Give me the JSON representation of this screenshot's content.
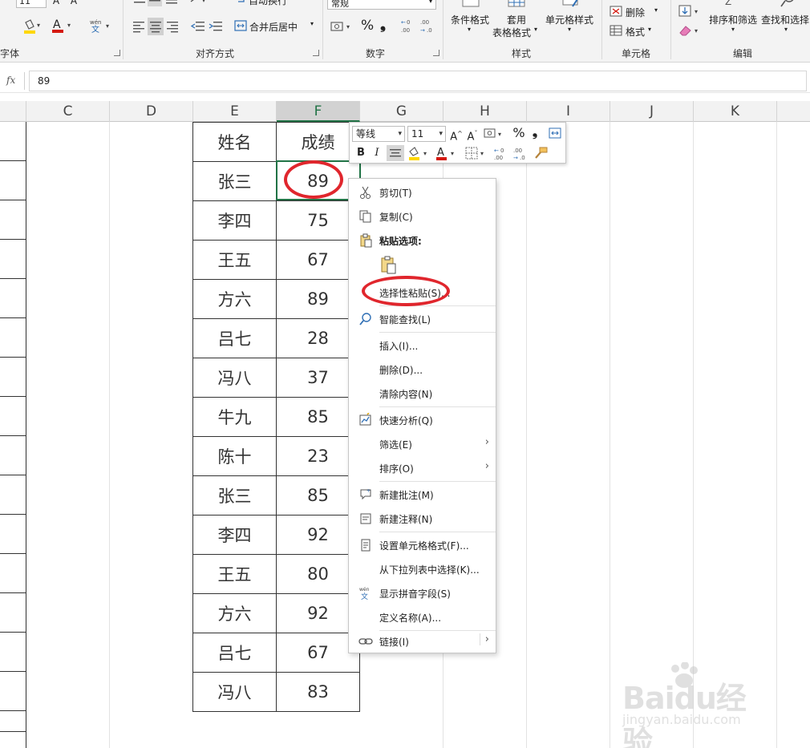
{
  "ribbon": {
    "font_group": {
      "label": "字体",
      "size_value": "11"
    },
    "align_group": {
      "label": "对齐方式",
      "wrap_label": "自动换行",
      "merge_label": "合并后居中"
    },
    "number_group": {
      "label": "数字",
      "format_value": "常规"
    },
    "style_group": {
      "label": "样式",
      "cond_format": "条件格式",
      "table_format_1": "套用",
      "table_format_2": "表格格式",
      "cell_style": "单元格样式"
    },
    "cells_group": {
      "label": "单元格",
      "delete": "删除",
      "format": "格式"
    },
    "edit_group": {
      "label": "编辑",
      "sort_filter": "排序和筛选",
      "find_select": "查找和选择"
    }
  },
  "formula_bar": {
    "fx": "fx",
    "value": "89"
  },
  "columns": [
    "C",
    "D",
    "E",
    "F",
    "G",
    "H",
    "I",
    "J",
    "K"
  ],
  "table": {
    "headers": [
      "姓名",
      "成绩"
    ],
    "rows": [
      [
        "张三",
        "89"
      ],
      [
        "李四",
        "75"
      ],
      [
        "王五",
        "67"
      ],
      [
        "方六",
        "89"
      ],
      [
        "吕七",
        "28"
      ],
      [
        "冯八",
        "37"
      ],
      [
        "牛九",
        "85"
      ],
      [
        "陈十",
        "23"
      ],
      [
        "张三",
        "85"
      ],
      [
        "李四",
        "92"
      ],
      [
        "王五",
        "80"
      ],
      [
        "方六",
        "92"
      ],
      [
        "吕七",
        "67"
      ],
      [
        "冯八",
        "83"
      ]
    ]
  },
  "mini_toolbar": {
    "font_name": "等线",
    "font_size": "11",
    "bold": "B",
    "italic": "I",
    "percent": "%",
    "comma": "❟"
  },
  "context_menu": {
    "cut": "剪切(T)",
    "copy": "复制(C)",
    "paste_options": "粘贴选项:",
    "paste_special": "选择性粘贴(S)...",
    "smart_lookup": "智能查找(L)",
    "insert": "插入(I)...",
    "delete": "删除(D)...",
    "clear": "清除内容(N)",
    "quick_analysis": "快速分析(Q)",
    "filter": "筛选(E)",
    "sort": "排序(O)",
    "new_comment": "新建批注(M)",
    "new_note": "新建注释(N)",
    "format_cells": "设置单元格格式(F)...",
    "pick_list": "从下拉列表中选择(K)...",
    "phonetic": "显示拼音字段(S)",
    "define_name": "定义名称(A)...",
    "link": "链接(I)"
  },
  "watermark": {
    "brand": "Baidu经验",
    "url": "jingyan.baidu.com"
  },
  "colors": {
    "accent_green": "#217346",
    "annotation_red": "#e0262d",
    "highlight_yellow": "#ffd700",
    "font_red": "#d4190f"
  }
}
